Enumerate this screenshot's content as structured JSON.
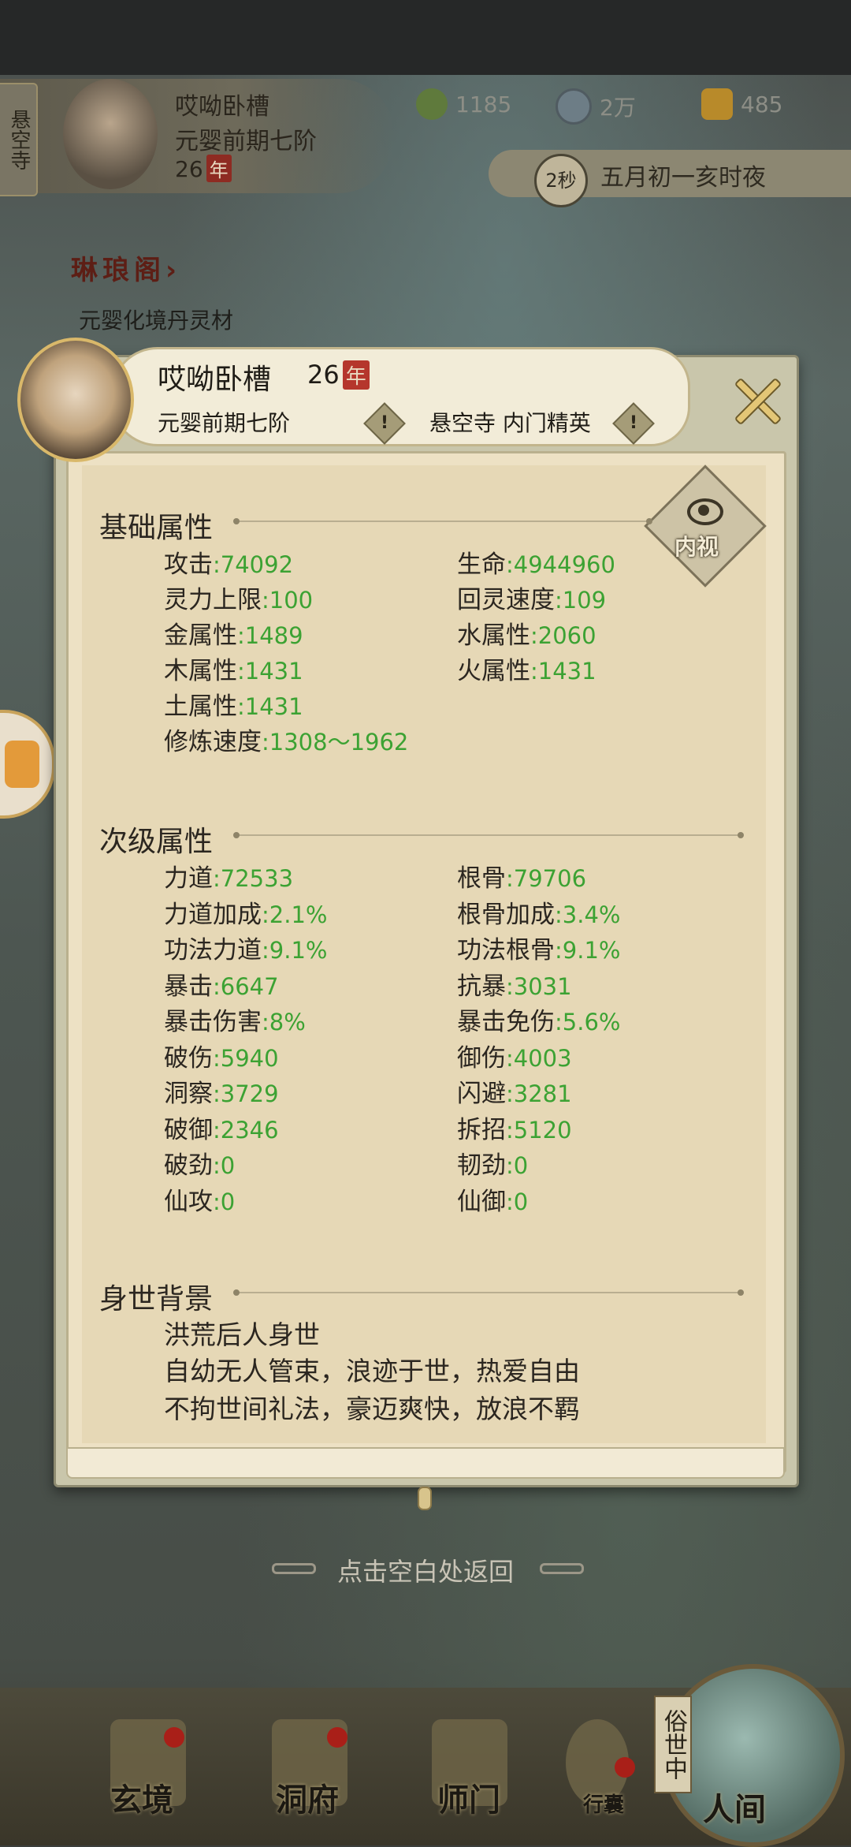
{
  "hud": {
    "temple_tab": "悬空寺",
    "player_name": "哎呦卧槽",
    "rank": "元婴前期七阶",
    "age": "26",
    "year_char": "年",
    "resources": [
      {
        "icon": "jade-leaf-icon",
        "value": "1185"
      },
      {
        "icon": "coin-icon",
        "value": "2万"
      },
      {
        "icon": "gold-ingot-icon",
        "value": "485"
      }
    ],
    "timer": "2秒",
    "date_text": "五月初一亥时夜",
    "pavilion_title": "琳琅阁",
    "pavilion_arrow": "›",
    "pavilion_sub": "元婴化境丹灵材"
  },
  "panel": {
    "name": "哎呦卧槽",
    "age": "26",
    "year_char": "年",
    "rank": "元婴前期七阶",
    "sect": "悬空寺 内门精英",
    "warn_mark": "!",
    "close_icon": "close-x-icon",
    "inner_view_label": "内视",
    "base_title": "基础属性",
    "base_attrs": [
      {
        "label": "攻击",
        "value": ":74092"
      },
      {
        "label": "生命",
        "value": ":4944960"
      },
      {
        "label": "灵力上限",
        "value": ":100"
      },
      {
        "label": "回灵速度",
        "value": ":109"
      },
      {
        "label": "金属性",
        "value": ":1489"
      },
      {
        "label": "水属性",
        "value": ":2060"
      },
      {
        "label": "木属性",
        "value": ":1431"
      },
      {
        "label": "火属性",
        "value": ":1431"
      },
      {
        "label": "土属性",
        "value": ":1431"
      },
      {
        "label": "修炼速度",
        "value": ":1308～1962"
      }
    ],
    "secondary_title": "次级属性",
    "secondary_attrs": [
      {
        "label": "力道",
        "value": ":72533"
      },
      {
        "label": "根骨",
        "value": ":79706"
      },
      {
        "label": "力道加成",
        "value": ":2.1%"
      },
      {
        "label": "根骨加成",
        "value": ":3.4%"
      },
      {
        "label": "功法力道",
        "value": ":9.1%"
      },
      {
        "label": "功法根骨",
        "value": ":9.1%"
      },
      {
        "label": "暴击",
        "value": ":6647"
      },
      {
        "label": "抗暴",
        "value": ":3031"
      },
      {
        "label": "暴击伤害",
        "value": ":8%"
      },
      {
        "label": "暴击免伤",
        "value": ":5.6%"
      },
      {
        "label": "破伤",
        "value": ":5940"
      },
      {
        "label": "御伤",
        "value": ":4003"
      },
      {
        "label": "洞察",
        "value": ":3729"
      },
      {
        "label": "闪避",
        "value": ":3281"
      },
      {
        "label": "破御",
        "value": ":2346"
      },
      {
        "label": "拆招",
        "value": ":5120"
      },
      {
        "label": "破劲",
        "value": ":0"
      },
      {
        "label": "韧劲",
        "value": ":0"
      },
      {
        "label": "仙攻",
        "value": ":0"
      },
      {
        "label": "仙御",
        "value": ":0"
      }
    ],
    "background_title": "身世背景",
    "background_lines": [
      "洪荒后人身世",
      "自幼无人管束，浪迹于世，热爱自由",
      "不拘世间礼法，豪迈爽快，放浪不羁"
    ]
  },
  "hint": "点击空白处返回",
  "nav": {
    "items": [
      "玄境",
      "洞府",
      "师门",
      "行囊",
      "人间"
    ],
    "secular_label": "俗世中"
  },
  "colors": {
    "value_green": "#3ca233",
    "panel_bg": "#e6d8b6",
    "badge_red": "#b5362c"
  }
}
